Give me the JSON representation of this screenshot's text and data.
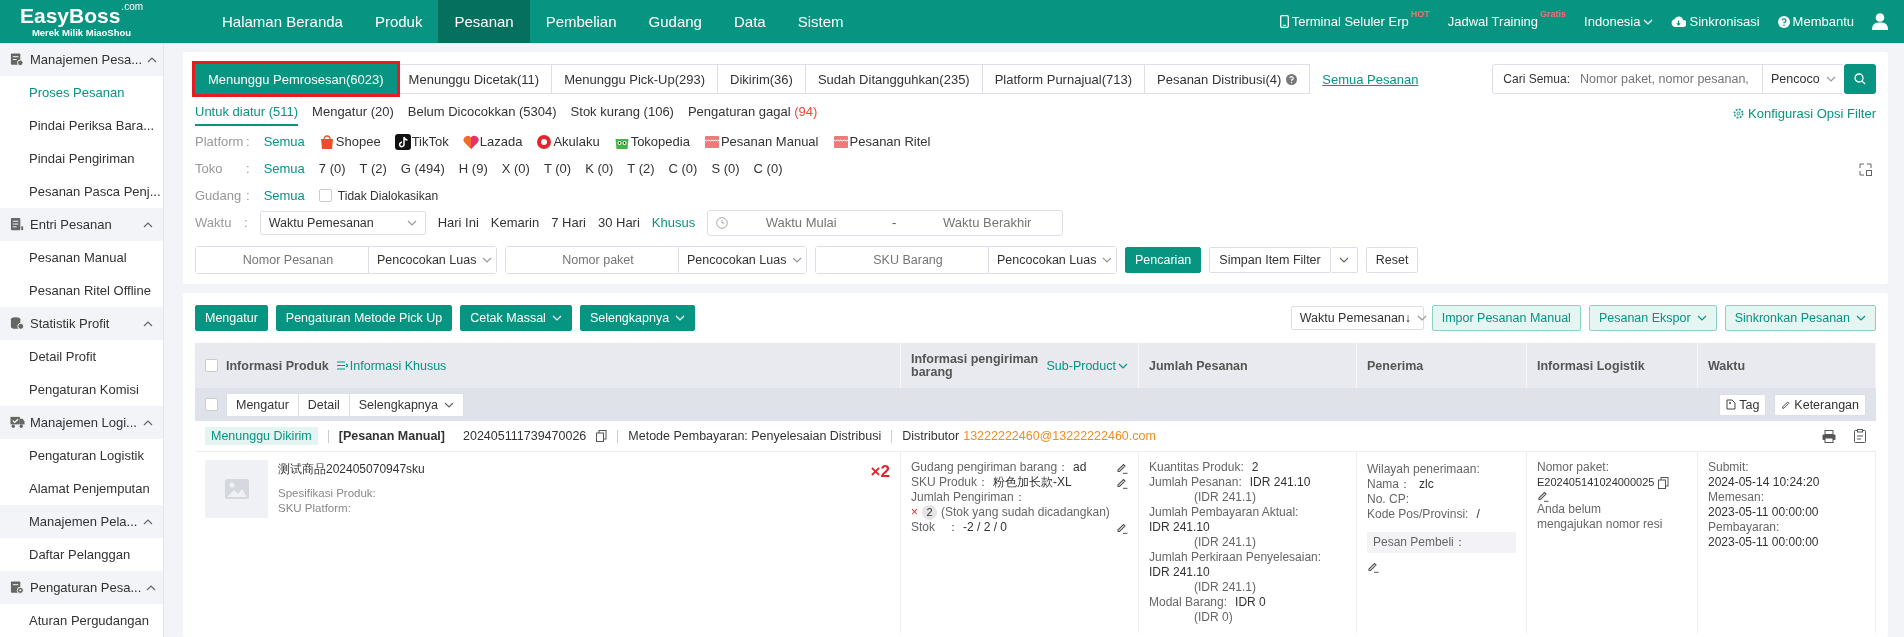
{
  "logo": {
    "name": "EasyBoss",
    "domain": ".com",
    "tagline": "Merek Milik MiaoShou"
  },
  "nav": [
    {
      "label": "Halaman Beranda",
      "selected": false
    },
    {
      "label": "Produk",
      "selected": false
    },
    {
      "label": "Pesanan",
      "selected": true
    },
    {
      "label": "Pembelian",
      "selected": false
    },
    {
      "label": "Gudang",
      "selected": false
    },
    {
      "label": "Data",
      "selected": false
    },
    {
      "label": "Sistem",
      "selected": false
    }
  ],
  "top_links": [
    {
      "label": "Terminal Seluler Erp",
      "kind": "phone",
      "badge": "HOT"
    },
    {
      "label": "Jadwal Training",
      "kind": "text",
      "badge": "Gratis"
    },
    {
      "label": "Indonesia",
      "kind": "dropdown"
    },
    {
      "label": "Sinkronisasi",
      "kind": "cloud"
    },
    {
      "label": "Membantu",
      "kind": "help"
    }
  ],
  "sidebar": [
    {
      "label": "Manajemen Pesa...",
      "kind": "order",
      "expanded": true,
      "children": [
        {
          "label": "Proses Pesanan",
          "selected": true
        },
        {
          "label": "Pindai Periksa Bara...",
          "selected": false
        },
        {
          "label": "Pindai Pengiriman",
          "selected": false
        },
        {
          "label": "Pesanan Pasca Penj...",
          "selected": false
        }
      ]
    },
    {
      "label": "Entri Pesanan",
      "kind": "entry",
      "expanded": true,
      "children": [
        {
          "label": "Pesanan Manual",
          "selected": false
        },
        {
          "label": "Pesanan Ritel Offline",
          "selected": false
        }
      ]
    },
    {
      "label": "Statistik Profit",
      "kind": "profit",
      "expanded": true,
      "children": [
        {
          "label": "Detail Profit",
          "selected": false
        },
        {
          "label": "Pengaturan Komisi",
          "selected": false
        }
      ]
    },
    {
      "label": "Manajemen Logi...",
      "kind": "truck",
      "expanded": true,
      "children": [
        {
          "label": "Pengaturan Logistik",
          "selected": false
        },
        {
          "label": "Alamat Penjemputan",
          "selected": false
        }
      ]
    },
    {
      "label": "Manajemen Pela...",
      "kind": "plain",
      "expanded": true,
      "children": [
        {
          "label": "Daftar Pelanggan",
          "selected": false
        }
      ]
    },
    {
      "label": "Pengaturan Pesa...",
      "kind": "settings",
      "expanded": true,
      "children": [
        {
          "label": "Aturan Pergudangan",
          "selected": false
        }
      ]
    }
  ],
  "status_tabs": [
    {
      "label": "Menunggu Pemrosesan(6023)",
      "selected": true,
      "highlighted": true,
      "help": false
    },
    {
      "label": "Menunggu Dicetak(11)",
      "selected": false,
      "highlighted": false,
      "help": false
    },
    {
      "label": "Menunggu Pick-Up(293)",
      "selected": false,
      "highlighted": false,
      "help": false
    },
    {
      "label": "Dikirim(36)",
      "selected": false,
      "highlighted": false,
      "help": false
    },
    {
      "label": "Sudah Ditangguhkan(235)",
      "selected": false,
      "highlighted": false,
      "help": false
    },
    {
      "label": "Platform Purnajual(713)",
      "selected": false,
      "highlighted": false,
      "help": false
    },
    {
      "label": "Pesanan Distribusi(4)",
      "selected": false,
      "highlighted": false,
      "help": true
    }
  ],
  "all_orders_link": "Semua Pesanan",
  "search": {
    "label": "Cari Semua:",
    "placeholder": "Nomor paket, nomor pesanan,",
    "mode": "Pencoco"
  },
  "filter_config": "Konfigurasi Opsi Filter",
  "sub_tabs": [
    {
      "label": "Untuk diatur (511)",
      "selected": true
    },
    {
      "label": "Mengatur (20)",
      "selected": false
    },
    {
      "label": "Belum Dicocokkan (5304)",
      "selected": false
    },
    {
      "label": "Stok kurang (106)",
      "selected": false
    },
    {
      "label": "Pengaturan gagal",
      "alert_count": "(94)",
      "selected": false
    }
  ],
  "filters": [
    {
      "label": "Platform",
      "colon": ":",
      "options": [
        {
          "label": "Semua",
          "kind": "plain",
          "selected": true
        },
        {
          "label": "Shopee",
          "kind": "shopee",
          "selected": false
        },
        {
          "label": "TikTok",
          "kind": "tiktok",
          "selected": false
        },
        {
          "label": "Lazada",
          "kind": "lazada",
          "selected": false
        },
        {
          "label": "Akulaku",
          "kind": "akulaku",
          "selected": false
        },
        {
          "label": "Tokopedia",
          "kind": "tokopedia",
          "selected": false
        },
        {
          "label": "Pesanan Manual",
          "kind": "store",
          "selected": false
        },
        {
          "label": "Pesanan Ritel",
          "kind": "store",
          "selected": false
        }
      ]
    },
    {
      "label": "Toko",
      "colon": ":",
      "options": [
        {
          "label": "Semua",
          "selected": true
        },
        {
          "label": "7 (0)",
          "selected": false
        },
        {
          "label": "T (2)",
          "selected": false
        },
        {
          "label": "G (494)",
          "selected": false
        },
        {
          "label": "H (9)",
          "selected": false
        },
        {
          "label": "X (0)",
          "selected": false
        },
        {
          "label": "T (0)",
          "selected": false
        },
        {
          "label": "K (0)",
          "selected": false
        },
        {
          "label": "T (2)",
          "selected": false
        },
        {
          "label": "C (0)",
          "selected": false
        },
        {
          "label": "S (0)",
          "selected": false
        },
        {
          "label": "C (0)",
          "selected": false
        }
      ]
    },
    {
      "label": "Gudang",
      "colon": ":",
      "options": [
        {
          "label": "Semua",
          "selected": true
        }
      ],
      "checkbox": {
        "label": "Tidak Dialokasikan",
        "checked": false
      }
    }
  ],
  "time_filter": {
    "label": "Waktu",
    "colon": ":",
    "select": "Waktu Pemesanan",
    "presets": [
      {
        "label": "Hari Ini",
        "selected": false
      },
      {
        "label": "Kemarin",
        "selected": false
      },
      {
        "label": "7 Hari",
        "selected": false
      },
      {
        "label": "30 Hari",
        "selected": false
      },
      {
        "label": "Khusus",
        "selected": true
      }
    ],
    "start_placeholder": "Waktu Mulai",
    "separator": "-",
    "end_placeholder": "Waktu Berakhir"
  },
  "search_fields": [
    {
      "placeholder": "Nomor Pesanan",
      "mode": "Pencocokan Luas"
    },
    {
      "placeholder": "Nomor paket",
      "mode": "Pencocokan Luas"
    },
    {
      "placeholder": "SKU Barang",
      "mode": "Pencocokan Luas"
    }
  ],
  "filter_buttons": [
    {
      "label": "Pencarian",
      "kind": "primary"
    },
    {
      "label": "Simpan Item Filter",
      "kind": "split"
    },
    {
      "label": "Reset",
      "kind": "plain"
    }
  ],
  "actions": [
    {
      "label": "Mengatur",
      "dropdown": false
    },
    {
      "label": "Pengaturan Metode Pick Up",
      "dropdown": false
    },
    {
      "label": "Cetak Massal",
      "dropdown": true
    },
    {
      "label": "Selengkapnya",
      "dropdown": true
    }
  ],
  "sort_select": "Waktu Pemesanan↓",
  "right_actions": [
    {
      "label": "Impor Pesanan Manual",
      "dropdown": false
    },
    {
      "label": "Pesanan Ekspor",
      "dropdown": true
    },
    {
      "label": "Sinkronkan Pesanan",
      "dropdown": true
    }
  ],
  "table": {
    "checked": false,
    "product_column": "Informasi Produk",
    "custom_info_link": "Informasi Khusus",
    "shipping_column": "Informasi pengiriman barang",
    "sub_product": "Sub-Product",
    "columns": [
      "Jumlah Pesanan",
      "Penerima",
      "Informasi Logistik",
      "Waktu"
    ]
  },
  "bulk_bar": {
    "checked": false,
    "buttons": [
      {
        "label": "Mengatur",
        "dropdown": false
      },
      {
        "label": "Detail",
        "dropdown": false
      },
      {
        "label": "Selengkapnya",
        "dropdown": true
      }
    ],
    "right_buttons": [
      {
        "label": "Tag",
        "kind": "tag"
      },
      {
        "label": "Keterangan",
        "kind": "edit"
      }
    ]
  },
  "orders": [
    {
      "status": "Menunggu Dikirim",
      "type": "[Pesanan Manual]",
      "order_no": "202405111739470026",
      "payment": "Metode Pembayaran: Penyelesaian Distribusi",
      "distributor_label": "Distributor",
      "distributor": "13222222460@13222222460.com",
      "product": {
        "name": "测试商品202405070947sku",
        "spec": "Spesifikasi Produk:",
        "platform_sku": "SKU Platform:",
        "quantity": "×2"
      },
      "shipping": [
        {
          "kind": "pair",
          "label": "Gudang pengiriman barang：",
          "value": "ad",
          "editable": true
        },
        {
          "kind": "pair",
          "label": "SKU Produk：",
          "value": "粉色加长款-XL",
          "editable": true
        },
        {
          "kind": "pair",
          "label": "Jumlah Pengiriman：",
          "editable": false
        },
        {
          "kind": "count",
          "label": "×",
          "value": "2",
          "note": "(Stok yang sudah dicadangkan)",
          "editable": false
        },
        {
          "kind": "pair",
          "label": "Stok　：",
          "value": "-2 / 2 / 0",
          "editable": true
        }
      ],
      "amounts": [
        {
          "kind": "pair",
          "label": "Kuantitas Produk:",
          "value": "2"
        },
        {
          "kind": "pair",
          "label": "Jumlah Pesanan:",
          "value": "IDR 241.10"
        },
        {
          "kind": "note",
          "value": "(IDR 241.1)"
        },
        {
          "kind": "label",
          "label": "Jumlah Pembayaran Aktual:"
        },
        {
          "kind": "value",
          "value": "IDR 241.10"
        },
        {
          "kind": "note",
          "value": "(IDR 241.1)"
        },
        {
          "kind": "label",
          "label": "Jumlah Perkiraan Penyelesaian:"
        },
        {
          "kind": "value",
          "value": "IDR 241.10"
        },
        {
          "kind": "note",
          "value": "(IDR 241.1)"
        },
        {
          "kind": "pair",
          "label": "Modal Barang:",
          "value": "IDR 0"
        },
        {
          "kind": "note",
          "value": "(IDR 0)"
        }
      ],
      "recipient": {
        "lines": [
          {
            "label": "Wilayah penerimaan:"
          },
          {
            "label": "Nama：",
            "value": "zlc"
          },
          {
            "label": "No. CP:"
          },
          {
            "label": "Kode Pos/Provinsi:",
            "value": "/"
          }
        ],
        "buyer_message": "Pesan Pembeli："
      },
      "logistics": {
        "label": "Nomor paket:",
        "package_no": "E202405141024000025",
        "note": "Anda belum mengajukan nomor resi"
      },
      "times": [
        {
          "label": "Submit:",
          "value": "2024-05-14 10:24:20"
        },
        {
          "label": "Memesan:",
          "value": "2023-05-11 00:00:00"
        },
        {
          "label": "Pembayaran:",
          "value": "2023-05-11 00:00:00"
        }
      ]
    }
  ]
}
